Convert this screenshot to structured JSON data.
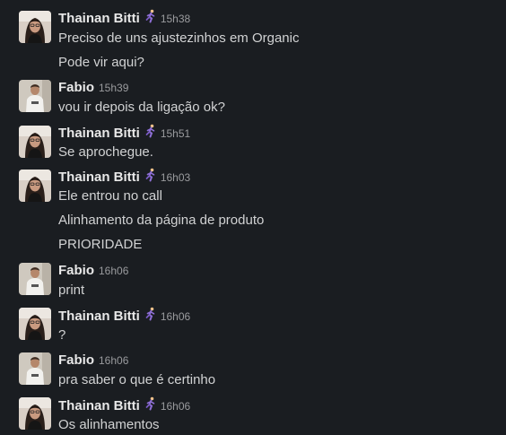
{
  "messages": [
    {
      "author": "Thainan Bitti",
      "avatar": "avatar-thainan",
      "emoji": "running-person-emoji",
      "time": "15h38",
      "lines": [
        "Preciso de uns ajustezinhos em Organic",
        "Pode vir aqui?"
      ]
    },
    {
      "author": "Fabio",
      "avatar": "avatar-fabio",
      "emoji": "",
      "time": "15h39",
      "lines": [
        "vou ir depois da ligação ok?"
      ]
    },
    {
      "author": "Thainan Bitti",
      "avatar": "avatar-thainan",
      "emoji": "running-person-emoji",
      "time": "15h51",
      "lines": [
        "Se aprochegue."
      ]
    },
    {
      "author": "Thainan Bitti",
      "avatar": "avatar-thainan",
      "emoji": "running-person-emoji",
      "time": "16h03",
      "lines": [
        "Ele entrou no call",
        "Alinhamento da página de produto",
        "PRIORIDADE"
      ]
    },
    {
      "author": "Fabio",
      "avatar": "avatar-fabio",
      "emoji": "",
      "time": "16h06",
      "lines": [
        "print"
      ]
    },
    {
      "author": "Thainan Bitti",
      "avatar": "avatar-thainan",
      "emoji": "running-person-emoji",
      "time": "16h06",
      "lines": [
        "?"
      ]
    },
    {
      "author": "Fabio",
      "avatar": "avatar-fabio",
      "emoji": "",
      "time": "16h06",
      "lines": [
        "pra saber o que é certinho"
      ]
    },
    {
      "author": "Thainan Bitti",
      "avatar": "avatar-thainan",
      "emoji": "running-person-emoji",
      "time": "16h06",
      "lines": [
        "Os alinhamentos"
      ]
    }
  ],
  "colors": {
    "background": "#1a1d21",
    "author": "#e8e8e8",
    "text": "#d1d2d3",
    "timestamp": "#9a9b9e"
  }
}
